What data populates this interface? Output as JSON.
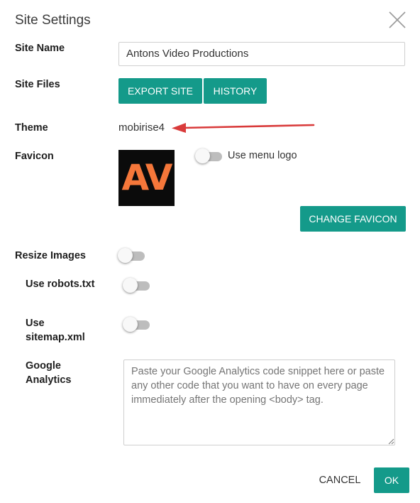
{
  "dialog": {
    "title": "Site Settings"
  },
  "site_name": {
    "label": "Site Name",
    "value": "Antons Video Productions"
  },
  "site_files": {
    "label": "Site Files",
    "export_label": "EXPORT SITE",
    "history_label": "HISTORY"
  },
  "theme": {
    "label": "Theme",
    "value": "mobirise4"
  },
  "favicon": {
    "label": "Favicon",
    "image_text": "AV",
    "use_menu_logo_label": "Use menu logo",
    "use_menu_logo_on": false,
    "change_label": "CHANGE FAVICON"
  },
  "resize_images": {
    "label": "Resize Images",
    "on": false
  },
  "robots": {
    "label": "Use robots.txt",
    "on": false
  },
  "sitemap": {
    "label_line1": "Use",
    "label_line2": "sitemap.xml",
    "on": false
  },
  "analytics": {
    "label_line1": "Google",
    "label_line2": "Analytics",
    "placeholder": "Paste your Google Analytics code snippet here or paste any other code that you want to have on every page immediately after the opening <body> tag."
  },
  "footer": {
    "cancel_label": "CANCEL",
    "ok_label": "OK"
  },
  "colors": {
    "accent": "#149a8a",
    "annotation_arrow": "#d93b3b",
    "favicon_text": "#f5773a"
  }
}
